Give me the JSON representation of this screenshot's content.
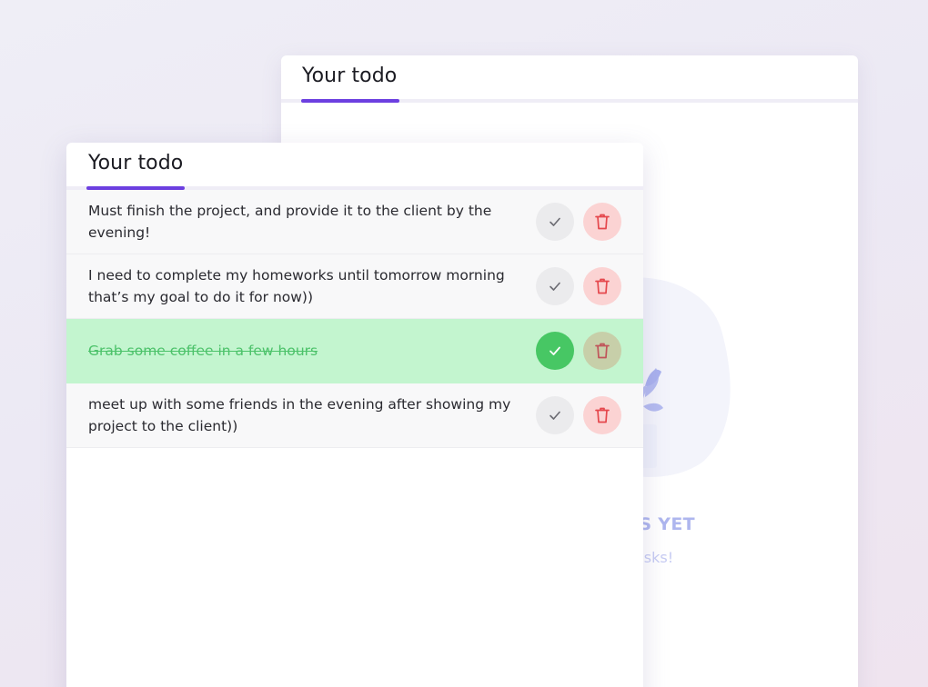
{
  "back_card": {
    "title": "Your todo",
    "empty_title": "NO TASKS YET",
    "empty_subtitle": "Add some tasks!"
  },
  "front_card": {
    "title": "Your todo",
    "todos": [
      {
        "text": "Must finish the project, and provide it to the client by the evening!",
        "completed": false
      },
      {
        "text": "I need to complete my homeworks until tomorrow morning that’s my goal to do it for now))",
        "completed": false
      },
      {
        "text": "Grab some coffee in a few hours",
        "completed": true
      },
      {
        "text": "meet up with some friends in the evening after showing my project to the client))",
        "completed": false
      }
    ]
  },
  "icons": {
    "complete": "checkmark-icon",
    "delete": "trash-icon",
    "empty_state": "plant-illustration"
  },
  "colors": {
    "accent": "#6c3fe0",
    "completed_row": "#c3f5cf",
    "completed_text": "#4cc26a",
    "check_active": "#47c764",
    "delete_bg": "#fbd3d3",
    "delete_icon": "#e5484d",
    "empty_state_text": "#aeb6ee"
  }
}
